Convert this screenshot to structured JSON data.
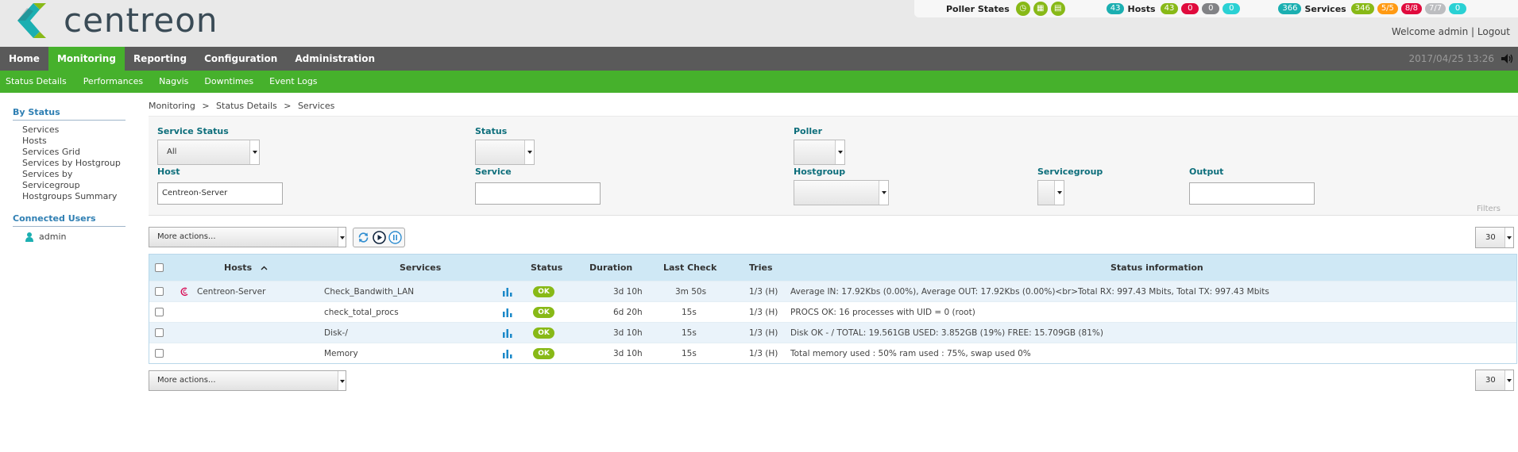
{
  "header": {
    "logo_text": "centreon",
    "poller_states_label": "Poller States",
    "hosts": {
      "total": "43",
      "label": "Hosts",
      "up": "43",
      "down": "0",
      "unreachable": "0",
      "pending": "0"
    },
    "services": {
      "total": "366",
      "label": "Services",
      "ok": "346",
      "warning": "5/5",
      "critical": "8/8",
      "unknown": "7/7",
      "pending": "0"
    },
    "welcome_text": "Welcome admin | ",
    "logout_label": "Logout",
    "colors": {
      "ok": "#88b917",
      "warning": "#ff9a13",
      "critical": "#e00b3d",
      "unknown": "#bcbdc0",
      "pending": "#2ad1d4",
      "total": "#1bafb1"
    }
  },
  "menu": {
    "items": [
      "Home",
      "Monitoring",
      "Reporting",
      "Configuration",
      "Administration"
    ],
    "active": "Monitoring",
    "datetime": "2017/04/25 13:26"
  },
  "submenu": {
    "items": [
      "Status  Details",
      "Performances",
      "Nagvis",
      "Downtimes",
      "Event  Logs"
    ]
  },
  "sidebar": {
    "by_status_title": "By Status",
    "links": [
      "Services",
      "Hosts",
      "Services Grid",
      "Services by Hostgroup",
      "Services by Servicegroup",
      "Hostgroups Summary"
    ],
    "connected_title": "Connected Users",
    "users": [
      "admin"
    ]
  },
  "breadcrumb": {
    "items": [
      "Monitoring",
      "Status Details",
      "Services"
    ],
    "separator": ">"
  },
  "filters": {
    "service_status_label": "Service Status",
    "service_status_value": "All",
    "status_label": "Status",
    "poller_label": "Poller",
    "host_label": "Host",
    "host_value": "Centreon-Server",
    "service_label": "Service",
    "hostgroup_label": "Hostgroup",
    "servicegroup_label": "Servicegroup",
    "output_label": "Output",
    "filters_word": "Filters"
  },
  "actions": {
    "more_actions": "More actions...",
    "pagination": "30"
  },
  "table": {
    "headers": {
      "hosts": "Hosts",
      "services": "Services",
      "status": "Status",
      "duration": "Duration",
      "last_check": "Last Check",
      "tries": "Tries",
      "status_info": "Status information"
    },
    "rows": [
      {
        "host": "Centreon-Server",
        "service": "Check_Bandwith_LAN",
        "status": "OK",
        "duration": "3d 10h",
        "last_check": "3m 50s",
        "tries": "1/3 (H)",
        "info": "Average IN: 17.92Kbs (0.00%), Average OUT: 17.92Kbs (0.00%)<br>Total RX: 997.43 Mbits, Total TX: 997.43 Mbits"
      },
      {
        "host": "",
        "service": "check_total_procs",
        "status": "OK",
        "duration": "6d 20h",
        "last_check": "15s",
        "tries": "1/3 (H)",
        "info": "PROCS OK: 16 processes with UID = 0 (root)"
      },
      {
        "host": "",
        "service": "Disk-/",
        "status": "OK",
        "duration": "3d 10h",
        "last_check": "15s",
        "tries": "1/3 (H)",
        "info": "Disk OK - / TOTAL: 19.561GB USED: 3.852GB (19%) FREE: 15.709GB (81%)"
      },
      {
        "host": "",
        "service": "Memory",
        "status": "OK",
        "duration": "3d 10h",
        "last_check": "15s",
        "tries": "1/3 (H)",
        "info": "Total memory used : 50% ram used : 75%, swap used 0%"
      }
    ]
  }
}
